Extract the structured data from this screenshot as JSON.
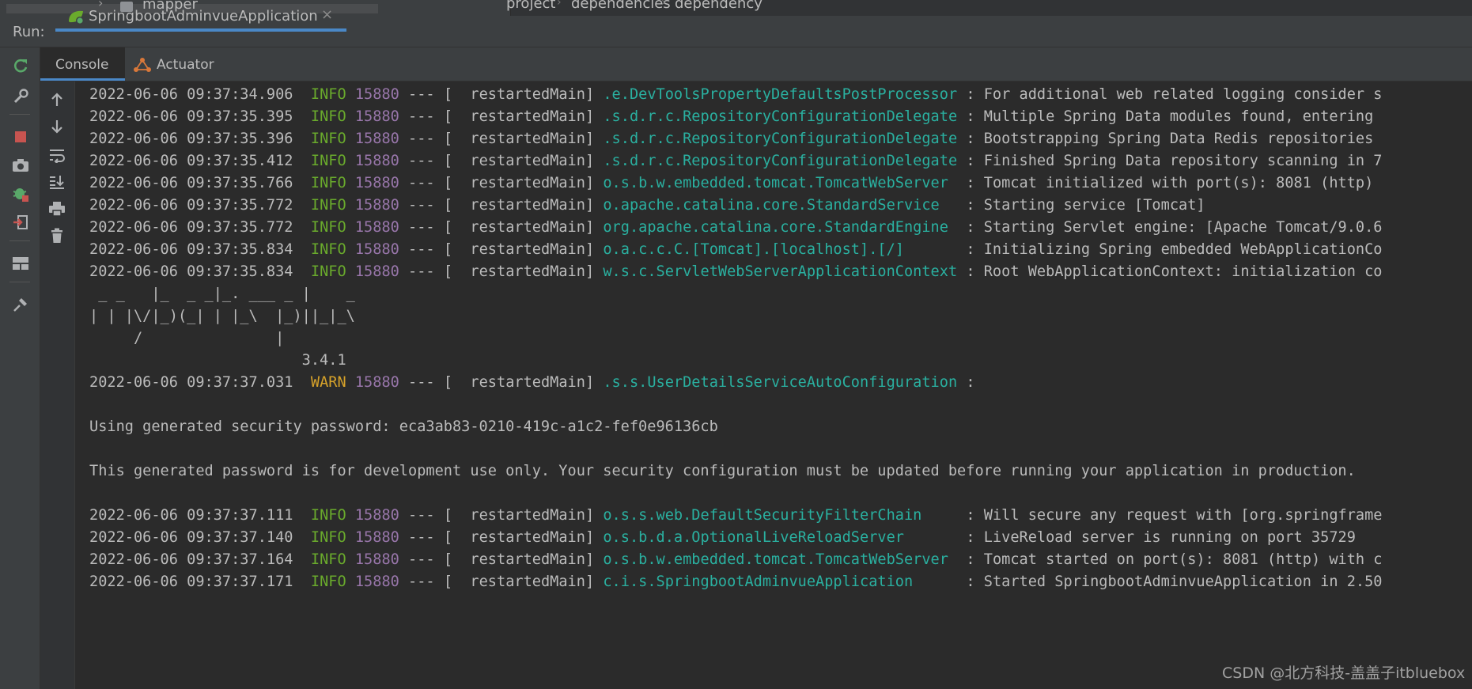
{
  "project_tree": {
    "item_label": "mapper"
  },
  "breadcrumb": [
    "project",
    "dependencies",
    "dependency"
  ],
  "run_bar": {
    "label": "Run:",
    "config_name": "SpringbootAdminvueApplication",
    "close_glyph": "×"
  },
  "tool_icons": [
    "rerun-icon",
    "wrench-icon",
    "stop-icon",
    "camera-icon",
    "debug-bug-icon",
    "exit-icon",
    "layout-icon",
    "pin-icon"
  ],
  "console_toolbar_icons": [
    "scroll-up-icon",
    "scroll-down-icon",
    "soft-wrap-icon",
    "scroll-to-end-icon",
    "print-icon",
    "trash-icon"
  ],
  "tabs": {
    "console": "Console",
    "actuator": "Actuator"
  },
  "colors": {
    "background": "#2b2b2b",
    "panel": "#3c3f41",
    "info": "#6aab2c",
    "warn": "#d6a22a",
    "pid": "#9876aa",
    "logger": "#2ab0a0",
    "accent": "#4a88c7",
    "stop": "#c75450",
    "rerun": "#59a869"
  },
  "console": {
    "log1": [
      {
        "ts": "2022-06-06 09:37:34.906",
        "level": "INFO",
        "pid": "15880",
        "sep": "--- [",
        "thread": "  restartedMain]",
        "logger": ".e.DevToolsPropertyDefaultsPostProcessor",
        "pad": "",
        "msg": ": For additional web related logging consider s"
      },
      {
        "ts": "2022-06-06 09:37:35.395",
        "level": "INFO",
        "pid": "15880",
        "sep": "--- [",
        "thread": "  restartedMain]",
        "logger": ".s.d.r.c.RepositoryConfigurationDelegate",
        "pad": "",
        "msg": ": Multiple Spring Data modules found, entering"
      },
      {
        "ts": "2022-06-06 09:37:35.396",
        "level": "INFO",
        "pid": "15880",
        "sep": "--- [",
        "thread": "  restartedMain]",
        "logger": ".s.d.r.c.RepositoryConfigurationDelegate",
        "pad": "",
        "msg": ": Bootstrapping Spring Data Redis repositories"
      },
      {
        "ts": "2022-06-06 09:37:35.412",
        "level": "INFO",
        "pid": "15880",
        "sep": "--- [",
        "thread": "  restartedMain]",
        "logger": ".s.d.r.c.RepositoryConfigurationDelegate",
        "pad": "",
        "msg": ": Finished Spring Data repository scanning in 7"
      },
      {
        "ts": "2022-06-06 09:37:35.766",
        "level": "INFO",
        "pid": "15880",
        "sep": "--- [",
        "thread": "  restartedMain]",
        "logger": "o.s.b.w.embedded.tomcat.TomcatWebServer",
        "pad": " ",
        "msg": ": Tomcat initialized with port(s): 8081 (http)"
      },
      {
        "ts": "2022-06-06 09:37:35.772",
        "level": "INFO",
        "pid": "15880",
        "sep": "--- [",
        "thread": "  restartedMain]",
        "logger": "o.apache.catalina.core.StandardService",
        "pad": "  ",
        "msg": ": Starting service [Tomcat]"
      },
      {
        "ts": "2022-06-06 09:37:35.772",
        "level": "INFO",
        "pid": "15880",
        "sep": "--- [",
        "thread": "  restartedMain]",
        "logger": "org.apache.catalina.core.StandardEngine",
        "pad": " ",
        "msg": ": Starting Servlet engine: [Apache Tomcat/9.0.6"
      },
      {
        "ts": "2022-06-06 09:37:35.834",
        "level": "INFO",
        "pid": "15880",
        "sep": "--- [",
        "thread": "  restartedMain]",
        "logger": "o.a.c.c.C.[Tomcat].[localhost].[/]",
        "pad": "      ",
        "msg": ": Initializing Spring embedded WebApplicationCo"
      },
      {
        "ts": "2022-06-06 09:37:35.834",
        "level": "INFO",
        "pid": "15880",
        "sep": "--- [",
        "thread": "  restartedMain]",
        "logger": "w.s.c.ServletWebServerApplicationContext",
        "pad": "",
        "msg": ": Root WebApplicationContext: initialization co"
      }
    ],
    "banner": [
      " _ _   |_  _ _|_. ___ _ |    _",
      "| | |\\/|_)(_| | |_\\  |_)||_|_\\",
      "     /               |",
      "                        3.4.1"
    ],
    "warn": {
      "ts": "2022-06-06 09:37:37.031",
      "level": "WARN",
      "pid": "15880",
      "sep": "--- [",
      "thread": "  restartedMain]",
      "logger": ".s.s.UserDetailsServiceAutoConfiguration",
      "pad": "",
      "msg": ":"
    },
    "password_line": "Using generated security password: eca3ab83-0210-419c-a1c2-fef0e96136cb",
    "dev_note": "This generated password is for development use only. Your security configuration must be updated before running your application in production.",
    "log2": [
      {
        "ts": "2022-06-06 09:37:37.111",
        "level": "INFO",
        "pid": "15880",
        "sep": "--- [",
        "thread": "  restartedMain]",
        "logger": "o.s.s.web.DefaultSecurityFilterChain",
        "pad": "    ",
        "msg": ": Will secure any request with [org.springframe"
      },
      {
        "ts": "2022-06-06 09:37:37.140",
        "level": "INFO",
        "pid": "15880",
        "sep": "--- [",
        "thread": "  restartedMain]",
        "logger": "o.s.b.d.a.OptionalLiveReloadServer",
        "pad": "      ",
        "msg": ": LiveReload server is running on port 35729"
      },
      {
        "ts": "2022-06-06 09:37:37.164",
        "level": "INFO",
        "pid": "15880",
        "sep": "--- [",
        "thread": "  restartedMain]",
        "logger": "o.s.b.w.embedded.tomcat.TomcatWebServer",
        "pad": " ",
        "msg": ": Tomcat started on port(s): 8081 (http) with c"
      },
      {
        "ts": "2022-06-06 09:37:37.171",
        "level": "INFO",
        "pid": "15880",
        "sep": "--- [",
        "thread": "  restartedMain]",
        "logger": "c.i.s.SpringbootAdminvueApplication",
        "pad": "     ",
        "msg": ": Started SpringbootAdminvueApplication in 2.50"
      }
    ]
  },
  "watermark": "CSDN @北方科技-盖盖子itbluebox"
}
